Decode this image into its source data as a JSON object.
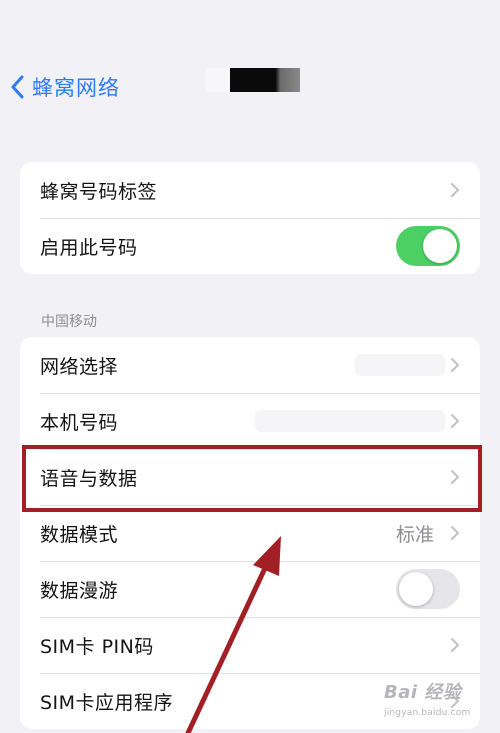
{
  "nav": {
    "back_label": "蜂窝网络"
  },
  "group1": {
    "rows": [
      {
        "label": "蜂窝号码标签",
        "accessory": "chevron"
      },
      {
        "label": "启用此号码",
        "accessory": "toggle",
        "toggle_on": true
      }
    ]
  },
  "section_header": "中国移动",
  "group2": {
    "rows": [
      {
        "label": "网络选择",
        "accessory": "chevron"
      },
      {
        "label": "本机号码",
        "accessory": "chevron"
      },
      {
        "label": "语音与数据",
        "accessory": "chevron",
        "highlighted": true
      },
      {
        "label": "数据模式",
        "value": "标准",
        "accessory": "chevron"
      },
      {
        "label": "数据漫游",
        "accessory": "toggle",
        "toggle_on": false
      },
      {
        "label": "SIM卡 PIN码",
        "accessory": "chevron"
      },
      {
        "label": "SIM卡应用程序",
        "accessory": "chevron"
      }
    ]
  },
  "watermark": {
    "logo": "Bai 经验",
    "sub": "jingyan.baidu.com"
  },
  "colors": {
    "accent_blue": "#2F7BF5",
    "toggle_on": "#4CD063",
    "toggle_off": "#E5E5EA",
    "highlight_red": "#A21F25",
    "background": "#F2F2F6"
  },
  "icons": {
    "back": "chevron-left-icon",
    "row_disclosure": "chevron-right-icon"
  }
}
